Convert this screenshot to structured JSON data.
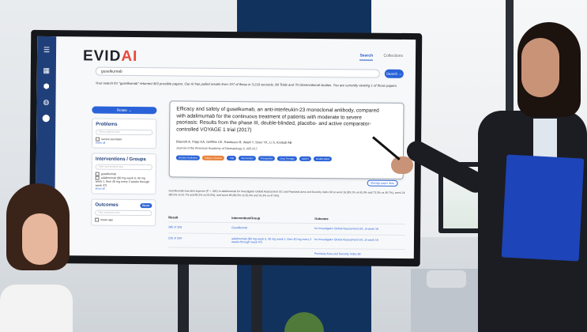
{
  "app": {
    "logo_main": "EVID",
    "logo_ai": "AI",
    "nav": [
      "Search",
      "Collections"
    ]
  },
  "search": {
    "query": "guselkumab",
    "button": "Search →",
    "summary": "Your search for \"guselkumab\" returned 403 possible papers. Our AI has pulled results from 197 of these in 3.218 seconds. 88 Trials and 70 Observational studies. You are currently viewing 1 of those papers."
  },
  "sidebar": {
    "pill": "Relate →",
    "problems": {
      "title": "Problems",
      "placeholder": "Filter problems here",
      "items": [
        "severe psoriasis"
      ],
      "more": "show all"
    },
    "interventions": {
      "title": "Interventions / Groups",
      "placeholder": "Filter interventions here",
      "items": [
        "guselkumab",
        "adalimumab (80 mg week 0, 40 mg week 1, then 40 mg every 2 weeks through week 47)"
      ],
      "more": "show all"
    },
    "outcomes": {
      "title": "Outcomes",
      "reset": "Reset",
      "placeholder": "Filter outcomes here",
      "items": [
        "mean age"
      ]
    }
  },
  "paper": {
    "title": "Efficacy and safety of guselkumab, an anti-interleukin-23 monoclonal antibody, compared with adalimumab for the continuous treatment of patients with moderate to severe psoriasis: Results from the phase III, double-blinded, placebo- and active comparator-controlled VOYAGE 1 trial (2017)",
    "authors": "Blauvelt A, Papp KA, Griffiths CE, Randazzo B, Wasfi Y, Shen YK, Li S, Kimball AB",
    "journal": "Journal of the American Academy of Dermatology 3; 405-417.",
    "tags": [
      {
        "label": "Review Published",
        "color": "#2a63d8"
      },
      {
        "label": "Subject: Disease",
        "color": "#e8833c"
      },
      {
        "label": "Trial",
        "color": "#2a63d8"
      },
      {
        "label": "Intervention",
        "color": "#2a63d8"
      },
      {
        "label": "Prospective",
        "color": "#2a63d8"
      },
      {
        "label": "Drug Therapy",
        "color": "#2a63d8"
      },
      {
        "label": "Adult 5",
        "color": "#2a63d8"
      },
      {
        "label": "Double Blind",
        "color": "#2a63d8"
      }
    ],
    "manage": "Manage paper data"
  },
  "abstract": "Guselkumab was also superior (P < .001) to adalimumab for Investigator Global Assessment 0/1 and Psoriasis Area and Severity Index 90 at week 16 (85.1% vs 65.9% and 73.3% vs 49.7%), week 24 (80.5% vs 61.7% and 80.2% vs 53.0%), and week 48 (80.5% vs 55.4% and 76.3% vs 47.9%).",
  "results_table": {
    "headers": [
      "Result",
      "Intervention/Group",
      "Outcome"
    ],
    "rows": [
      [
        "285 of 329",
        "Guselkumab",
        "for Investigator Global Assessment 0/1, at week 16"
      ],
      [
        "220 of 334",
        "adalimumab (80 mg week 0, 40 mg week 1, then 40 mg every 2 weeks through week 47)",
        "for Investigator Global Assessment 0/1, at week 16"
      ],
      [
        "",
        "",
        "Psoriasis Area and Severity Index 90"
      ]
    ]
  }
}
